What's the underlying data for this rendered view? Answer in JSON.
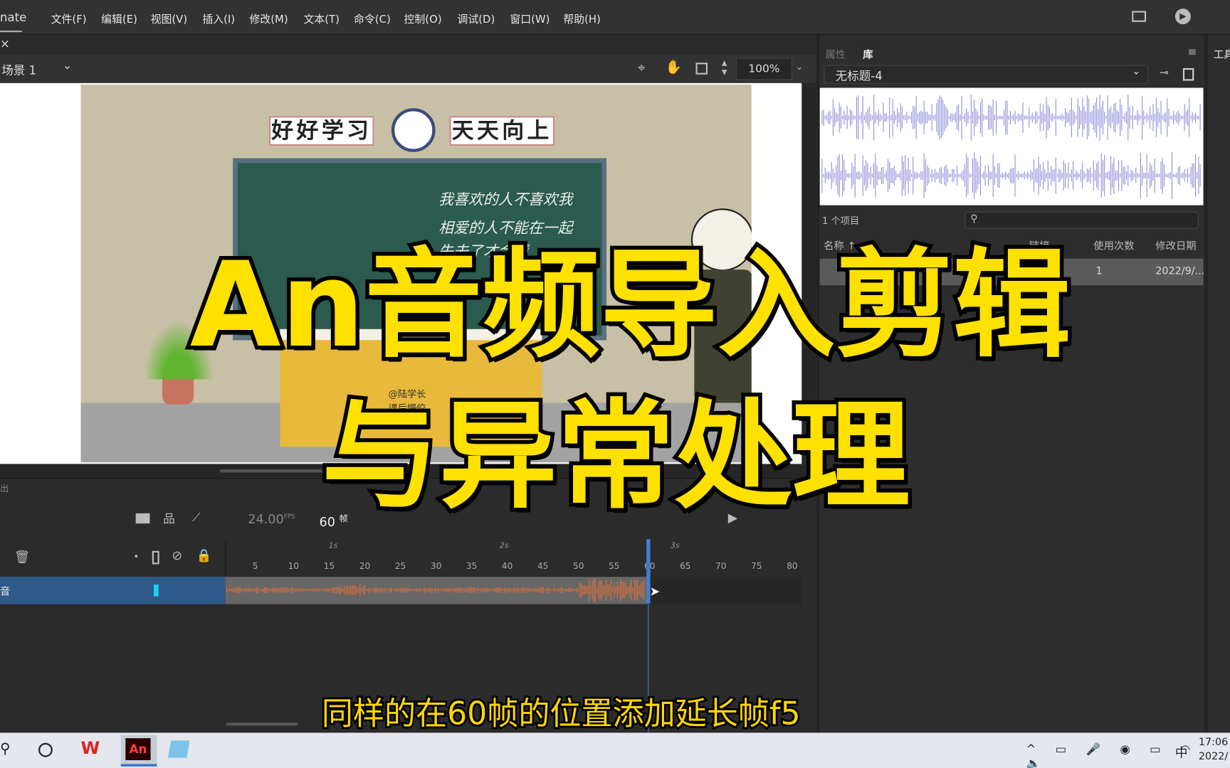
{
  "app": {
    "title_fragment": "nate"
  },
  "menu": [
    "文件(F)",
    "编辑(E)",
    "视图(V)",
    "插入(I)",
    "修改(M)",
    "文本(T)",
    "命令(C)",
    "控制(O)",
    "调试(D)",
    "窗口(W)",
    "帮助(H)"
  ],
  "tab": {
    "close": "×"
  },
  "scene": {
    "name": "场景 1",
    "zoom": "100%"
  },
  "stage": {
    "sign_left": "好好学习",
    "sign_right": "天天向上",
    "chalk": [
      "我喜欢的人不喜欢我",
      "相爱的人不能在一起",
      "失去了才会懂"
    ],
    "desk_text": [
      "@陆学长",
      "课后慢佼"
    ]
  },
  "library": {
    "tabs": [
      "属性",
      "库"
    ],
    "document": "无标题-4",
    "count": "1 个项目",
    "search_placeholder": "",
    "columns": [
      "名称",
      "链接",
      "使用次数",
      "修改日期"
    ],
    "rows": [
      {
        "name": "",
        "link": "",
        "uses": "1",
        "date": "2022/9/..."
      }
    ]
  },
  "tools": {
    "label": "工具"
  },
  "timeline": {
    "panel_label": "出",
    "fps": "24.00",
    "fps_unit": "FPS",
    "frame": "60",
    "frame_unit": "帧",
    "seconds": [
      "1s",
      "2s",
      "3s"
    ],
    "ticks": [
      "5",
      "10",
      "15",
      "20",
      "25",
      "30",
      "35",
      "40",
      "45",
      "50",
      "55",
      "60",
      "65",
      "70",
      "75",
      "80"
    ],
    "layer_name": "音",
    "current_frame": 60
  },
  "overlay": {
    "title_line1": "An音频导入剪辑",
    "title_line2": "与异常处理",
    "subtitle": "同样的在60帧的位置添加延长帧f5"
  },
  "taskbar": {
    "ime": "中",
    "time": "17:06",
    "date": "2022/"
  },
  "colors": {
    "accent": "#3d7fd6",
    "layer": "#2e5a8a",
    "waveform_timeline": "#e0703c",
    "waveform_library": "#8f8fdb",
    "overlay_text": "#ffe100"
  }
}
